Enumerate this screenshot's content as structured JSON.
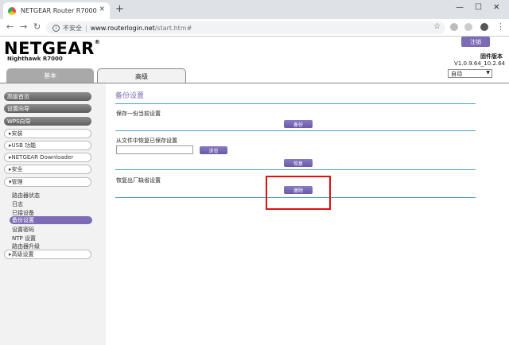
{
  "browser": {
    "tab_title": "NETGEAR Router R7000",
    "new_tab_symbol": "+",
    "security_label": "不安全",
    "separator": "|",
    "url_host": "www.routerlogin.net",
    "url_path": "/start.htm#",
    "window_controls": {
      "minimize": "—",
      "maximize": "☐",
      "close": "✕"
    }
  },
  "header": {
    "logo": "NETGEAR",
    "logo_mark": "®",
    "model": "Nighthawk R7000",
    "logout_label": "注销",
    "firmware_label": "固件版本",
    "firmware_version": "V1.0.9.64_10.2.64",
    "language": "自动"
  },
  "top_tabs": {
    "basic": "基本",
    "advanced": "高级"
  },
  "sidebar": {
    "top_items": [
      "高级首页",
      "设置向导",
      "WPS向导"
    ],
    "menu_items": [
      "▸安装",
      "▸USB 功能",
      "▸NETGEAR Downloader",
      "▸安全",
      "▾管理"
    ],
    "sub_items": [
      "路由器状态",
      "日志",
      "已接设备",
      "备份设置",
      "设置密码",
      "NTP 设置",
      "路由器升级"
    ],
    "active_sub_item": "备份设置",
    "last_item": "▸高级设置"
  },
  "main": {
    "title": "备份设置",
    "save_label": "保存一份当前设置",
    "backup_button": "备份",
    "restore_label": "从文件中恢复已保存设置",
    "browse_button": "浏览",
    "restore_button": "恢复",
    "factory_label": "恢复出厂缺省设置",
    "erase_button": "擦除"
  },
  "colors": {
    "accent": "#7d6bb5",
    "divider": "#4aa3c4",
    "highlight": "#dd1111"
  }
}
